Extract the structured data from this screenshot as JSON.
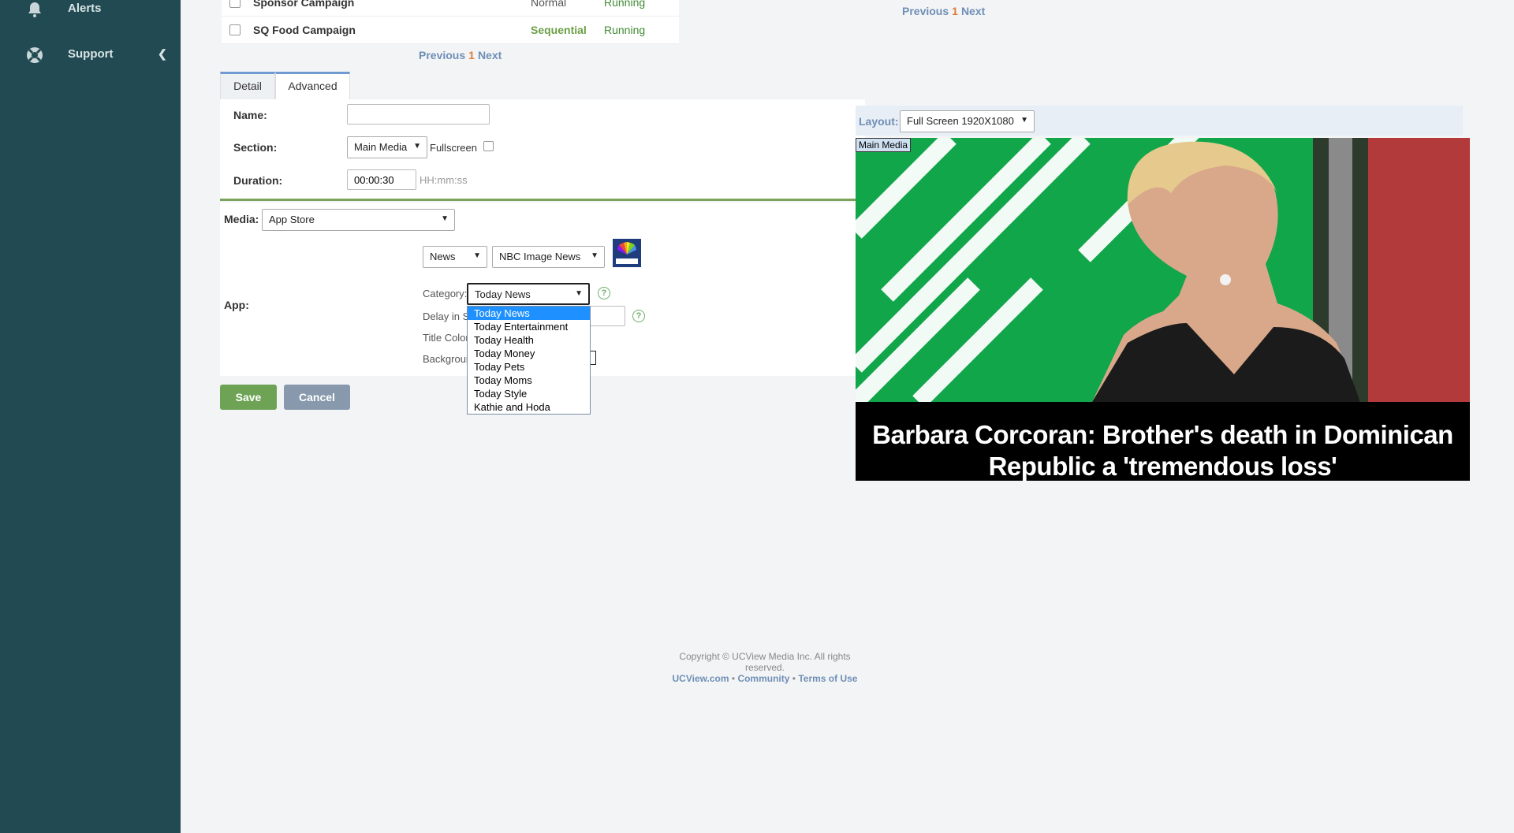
{
  "sidebar": {
    "items": [
      {
        "label": "Alerts",
        "icon": "bell-icon"
      },
      {
        "label": "Support",
        "icon": "lifebuoy-icon"
      }
    ]
  },
  "campaigns": {
    "rows": [
      {
        "name": "Sponsor Campaign",
        "type": "Normal",
        "status": "Running"
      },
      {
        "name": "SQ Food Campaign",
        "type": "Sequential",
        "status": "Running"
      }
    ]
  },
  "pager": {
    "prev": "Previous",
    "page": "1",
    "next": "Next"
  },
  "tabs": {
    "detail": "Detail",
    "advanced": "Advanced"
  },
  "form": {
    "name_label": "Name:",
    "name_value": "",
    "section_label": "Section:",
    "section_value": "Main Media",
    "fullscreen_label": "Fullscreen",
    "duration_label": "Duration:",
    "duration_value": "00:00:30",
    "duration_hint": "HH:mm:ss",
    "media_label": "Media:",
    "media_value": "App Store",
    "app_label": "App:",
    "app_type": "News",
    "app_feed": "NBC Image News",
    "category_label": "Category:",
    "category_value": "Today News",
    "delay_label": "Delay in S",
    "title_color_label": "Title Color",
    "background_label": "Backgrour",
    "category_options": [
      "Today News",
      "Today Entertainment",
      "Today Health",
      "Today Money",
      "Today Pets",
      "Today Moms",
      "Today Style",
      "Kathie and Hoda"
    ]
  },
  "buttons": {
    "save": "Save",
    "cancel": "Cancel"
  },
  "preview": {
    "layout_label": "Layout:",
    "layout_value": "Full Screen 1920X1080",
    "zone_label": "Main Media",
    "headline": "Barbara Corcoran: Brother's death in Dominican Republic a 'tremendous loss'"
  },
  "footer": {
    "copyright": "Copyright © UCView Media Inc. All rights reserved.",
    "links": [
      "UCView.com",
      "Community",
      "Terms of Use"
    ]
  },
  "colors": {
    "sidebar": "#224a52",
    "link": "#6f8fb6",
    "accent_green": "#7aa35c",
    "selected": "#1e90ff"
  }
}
